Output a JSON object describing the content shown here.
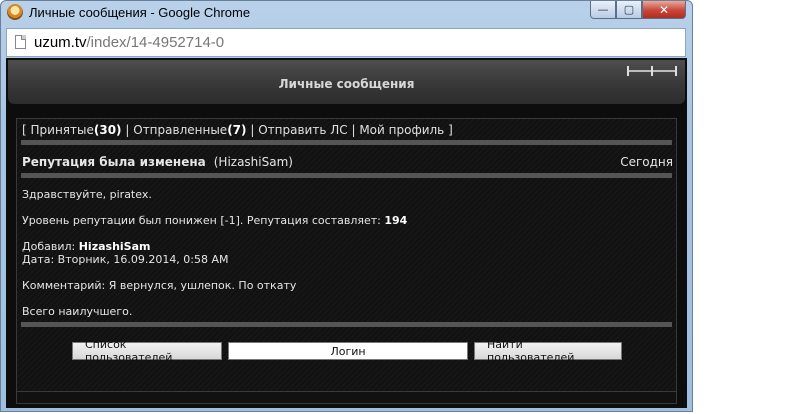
{
  "window": {
    "title": "Личные сообщения - Google Chrome",
    "minimize": "—",
    "maximize": "▢",
    "close": "✕"
  },
  "address": {
    "host": "uzum.tv",
    "path": "/index/14-4952714-0"
  },
  "page": {
    "header_title": "Личные сообщения",
    "nav": {
      "open": "[",
      "received_label": "Принятые",
      "received_count": "(30)",
      "sep1": "|",
      "sent_label": "Отправленные",
      "sent_count": "(7)",
      "sep2": "|",
      "send_label": "Отправить ЛС",
      "sep3": "|",
      "profile_label": "Мой профиль",
      "close": "]"
    },
    "message": {
      "subject": "Репутация была изменена",
      "sender": "(HizashiSam)",
      "date": "Сегодня",
      "greeting": "Здравствуйте, piratex.",
      "reputation_text": "Уровень репутации был понижен [-1]. Репутация составляет:",
      "reputation_value": "194",
      "added_label": "Добавил:",
      "added_by": "HizashiSam",
      "date_line": "Дата: Вторник, 16.09.2014, 0:58 AM",
      "comment": "Комментарий: Я вернулся, ушлепок. По откату",
      "closing": "Всего наилучшего."
    },
    "footer": {
      "users_list_button": "Список пользователей",
      "login_value": "Логин",
      "find_users_button": "Найти пользователей"
    }
  }
}
